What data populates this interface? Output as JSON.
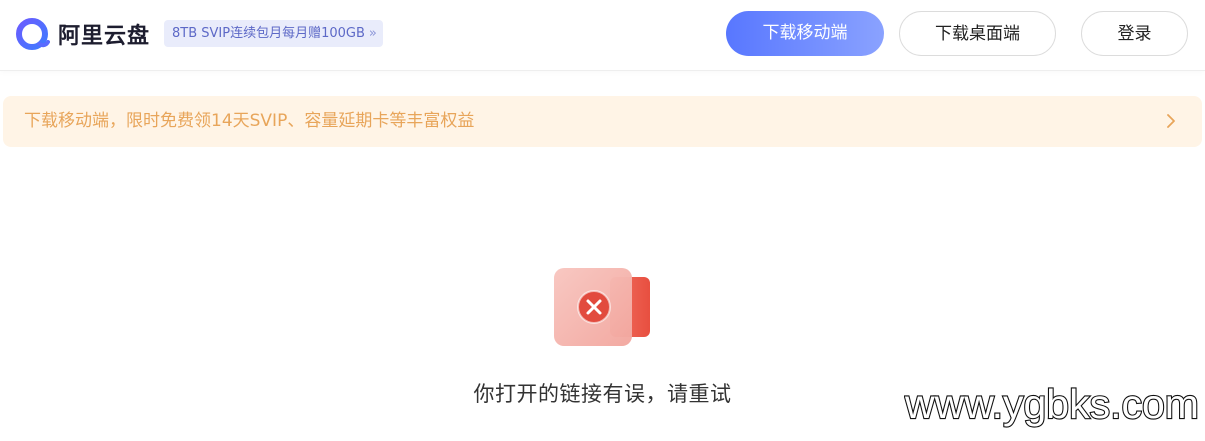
{
  "header": {
    "logo_text": "阿里云盘",
    "promo_badge": "8TB SVIP连续包月每月赠100GB",
    "promo_chevron": "»",
    "download_mobile_label": "下载移动端",
    "download_desktop_label": "下载桌面端",
    "login_label": "登录"
  },
  "notice": {
    "text": "下载移动端，限时免费领14天SVIP、容量延期卡等丰富权益"
  },
  "error": {
    "message": "你打开的链接有误，请重试",
    "icon": "close-icon"
  },
  "watermark": {
    "text": "www.ygbks.com"
  },
  "colors": {
    "accent": "#5877ff",
    "notice_bg": "#fff4e6",
    "notice_text": "#e8a55a",
    "error_red": "#e2463c"
  }
}
